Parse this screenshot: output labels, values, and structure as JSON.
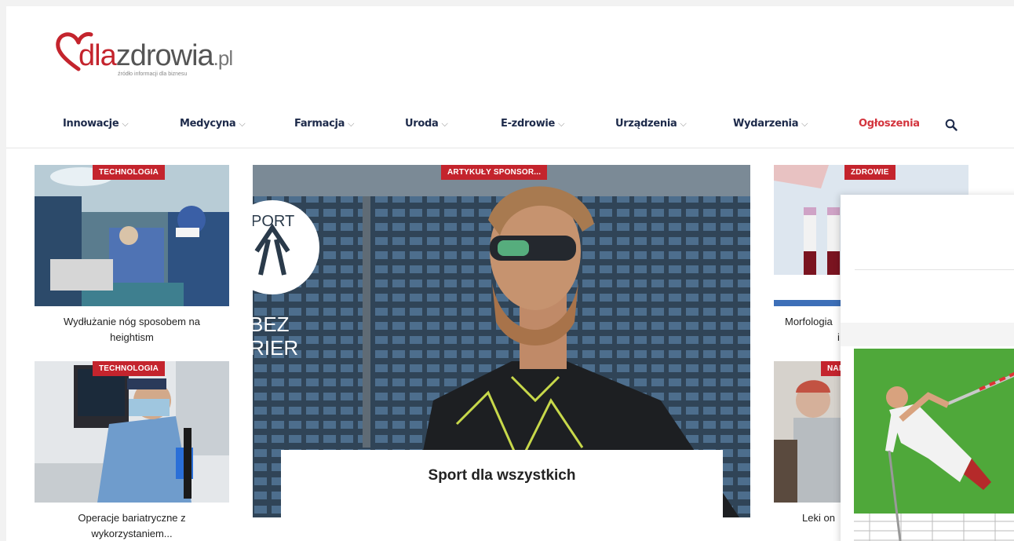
{
  "logo": {
    "dla": "dla",
    "zdrowia": "zdrowia",
    "pl": ".pl",
    "tagline": "źródło informacji dla biznesu"
  },
  "nav": {
    "items": [
      {
        "label": "Innowacje",
        "has_dropdown": true
      },
      {
        "label": "Medycyna",
        "has_dropdown": true
      },
      {
        "label": "Farmacja",
        "has_dropdown": true
      },
      {
        "label": "Uroda",
        "has_dropdown": true
      },
      {
        "label": "E-zdrowie",
        "has_dropdown": true
      },
      {
        "label": "Urządzenia",
        "has_dropdown": true
      },
      {
        "label": "Wydarzenia",
        "has_dropdown": true
      },
      {
        "label": "Ogłoszenia",
        "has_dropdown": false
      }
    ],
    "chevron": "⌵",
    "search_icon": "search-icon"
  },
  "cards": {
    "left_top": {
      "badge": "TECHNOLOGIA",
      "caption_line1": "Wydłużanie nóg sposobem na",
      "caption_line2": "heightism"
    },
    "left_bottom": {
      "badge": "TECHNOLOGIA",
      "caption_line1": "Operacje bariatryczne z",
      "caption_line2": "wykorzystaniem..."
    },
    "feature": {
      "badge": "ARTYKUŁY SPONSOR...",
      "title": "Sport dla wszystkich",
      "logo_text_1": "PORT",
      "logo_text_2": "BEZ",
      "logo_text_3": "RIER"
    },
    "right_top": {
      "badge": "ZDROWIE",
      "caption_partial": "Morfologia",
      "caption_partial2": "i"
    },
    "right_bottom": {
      "badge": "NAN",
      "caption_partial": "Leki on"
    }
  },
  "colors": {
    "accent": "#c4242d",
    "nav_text": "#1d2a4a",
    "nav_highlight": "#d3343d"
  }
}
